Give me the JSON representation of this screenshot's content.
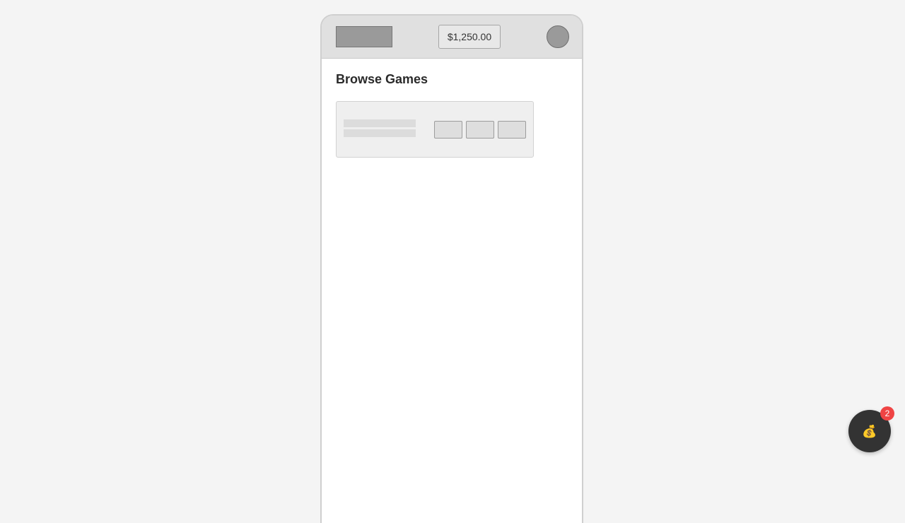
{
  "header": {
    "balance": "$1,250.00"
  },
  "main": {
    "title": "Browse Games"
  },
  "wallet_fab": {
    "icon": "money-bag-icon",
    "glyph": "💰",
    "badge_count": "2"
  },
  "colors": {
    "header_bg": "#e0e0e0",
    "fab_bg": "#333333",
    "badge": "#ef4444"
  }
}
